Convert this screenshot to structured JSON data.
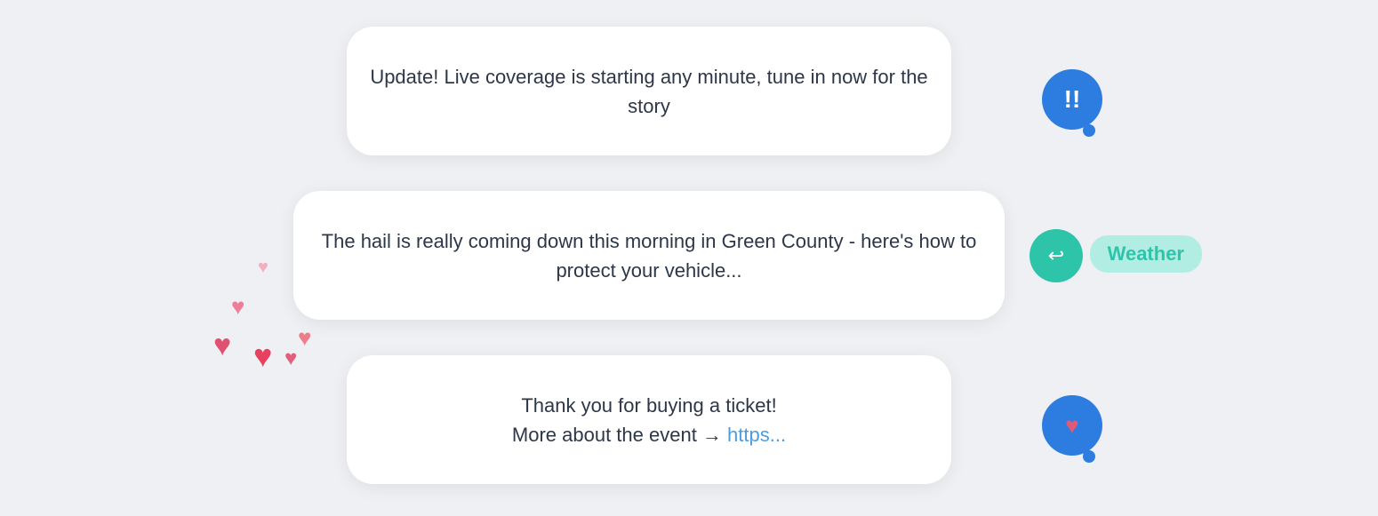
{
  "cards": {
    "card1": {
      "text": "Update! Live coverage is starting any minute, tune in now for the story",
      "icon": "exclamation",
      "icon_label": "alert-icon"
    },
    "card2": {
      "text": "The hail is really coming down this morning in Green County - here's how to protect your vehicle...",
      "icon": "arrow-redirect",
      "icon_label": "redirect-icon",
      "tag": "Weather"
    },
    "card3": {
      "text_part1": "Thank you for buying a ticket!",
      "text_part2": "More about the event → ",
      "link_text": "https...",
      "icon": "heart",
      "icon_label": "heart-icon"
    }
  },
  "hearts": {
    "count": 6,
    "label": "floating-hearts-decoration"
  },
  "colors": {
    "background": "#eef0f3",
    "card_bg": "#ffffff",
    "blue_bubble": "#2d7de0",
    "teal_bubble": "#2ec4a9",
    "teal_tag_bg": "#b2ede4",
    "teal_tag_text": "#2ec4a9",
    "link_color": "#4a9de0",
    "card_text": "#2d3748"
  }
}
